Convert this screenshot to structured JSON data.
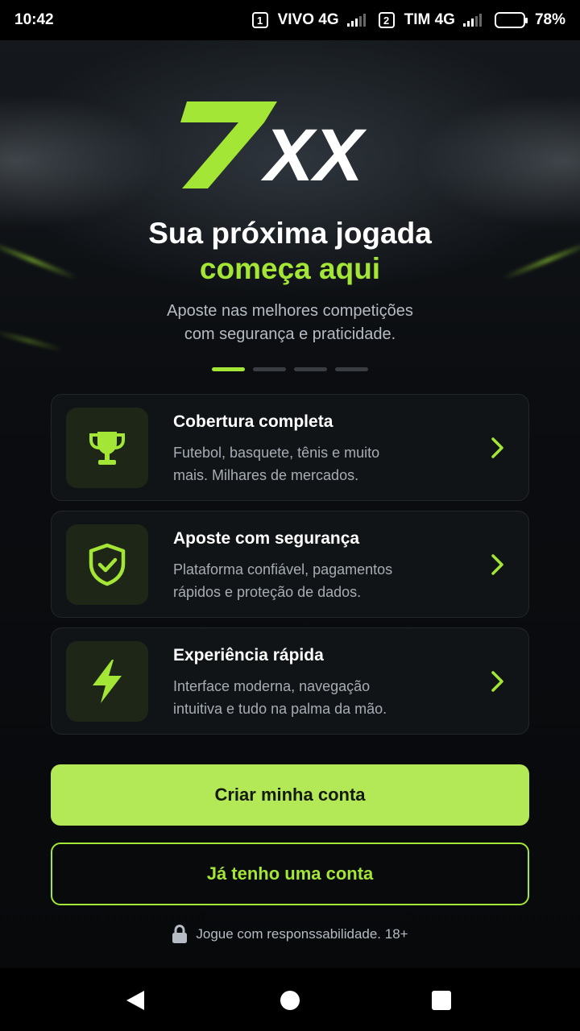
{
  "status_bar": {
    "time": "10:42",
    "sim1": {
      "slot": "1",
      "label": "VIVO 4G"
    },
    "sim2": {
      "slot": "2",
      "label": "TIM 4G"
    },
    "battery": "78%",
    "battery_level": 0.78
  },
  "brand": {
    "logo_prefix": "7",
    "logo_suffix": "XX",
    "accent_color": "#a3e635"
  },
  "hero": {
    "headline_line1": "Sua próxima jogada",
    "headline_line2": "começa aqui",
    "subtitle_line1": "Aposte nas melhores competições",
    "subtitle_line2": "com segurança e praticidade."
  },
  "carousel": {
    "total": 4,
    "active_index": 0
  },
  "features": [
    {
      "icon": "trophy-icon",
      "title": "Cobertura completa",
      "desc_line1": "Futebol, basquete, tênis e muito",
      "desc_line2": "mais. Milhares de mercados."
    },
    {
      "icon": "shield-check-icon",
      "title": "Aposte com segurança",
      "desc_line1": "Plataforma confiável, pagamentos",
      "desc_line2": "rápidos e proteção de dados."
    },
    {
      "icon": "lightning-icon",
      "title": "Experiência rápida",
      "desc_line1": "Interface moderna, navegação",
      "desc_line2": "intuitiva e tudo na palma da mão."
    }
  ],
  "actions": {
    "primary_label": "Criar minha conta",
    "secondary_label": "Já tenho uma conta"
  },
  "footer": {
    "icon": "lock-icon",
    "text": "Jogue com responssabilidade. 18+"
  },
  "nav": {
    "back": "back-icon",
    "home": "home-icon",
    "recents": "recents-icon"
  }
}
